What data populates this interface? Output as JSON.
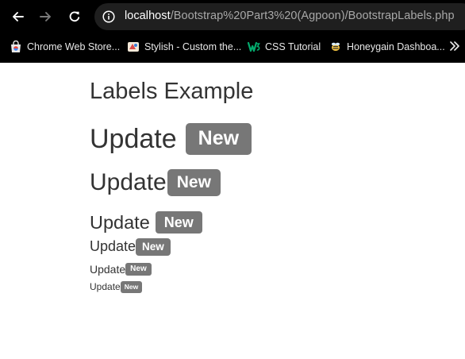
{
  "browser": {
    "url_host": "localhost",
    "url_path": "/Bootstrap%20Part3%20(Agpoon)/BootstrapLabels.php",
    "icons": {
      "back": "arrow-left-icon",
      "forward": "arrow-right-icon",
      "reload": "reload-icon",
      "site_info": "info-icon",
      "more_bookmarks": "chevron-double-right-icon"
    },
    "bookmarks": [
      {
        "label": "Chrome Web Store...",
        "icon": "chrome-web-store-icon"
      },
      {
        "label": "Stylish - Custom the...",
        "icon": "stylish-icon"
      },
      {
        "label": "CSS Tutorial",
        "icon": "w3schools-icon"
      },
      {
        "label": "Honeygain Dashboa...",
        "icon": "honeygain-icon"
      }
    ]
  },
  "page": {
    "title": "Labels Example",
    "headings": [
      {
        "level": "h1",
        "text": "Update",
        "label": "New"
      },
      {
        "level": "h2",
        "text": "Update",
        "label": "New"
      },
      {
        "level": "h3",
        "text": "Update",
        "label": "New"
      },
      {
        "level": "h4",
        "text": "Update",
        "label": "New"
      },
      {
        "level": "h5",
        "text": "Update",
        "label": "New"
      },
      {
        "level": "h6",
        "text": "Update",
        "label": "New"
      }
    ]
  },
  "colors": {
    "chrome_background": "#000000",
    "omnibox_background": "#1f1f1f",
    "label_default": "#777777",
    "text": "#333333"
  }
}
